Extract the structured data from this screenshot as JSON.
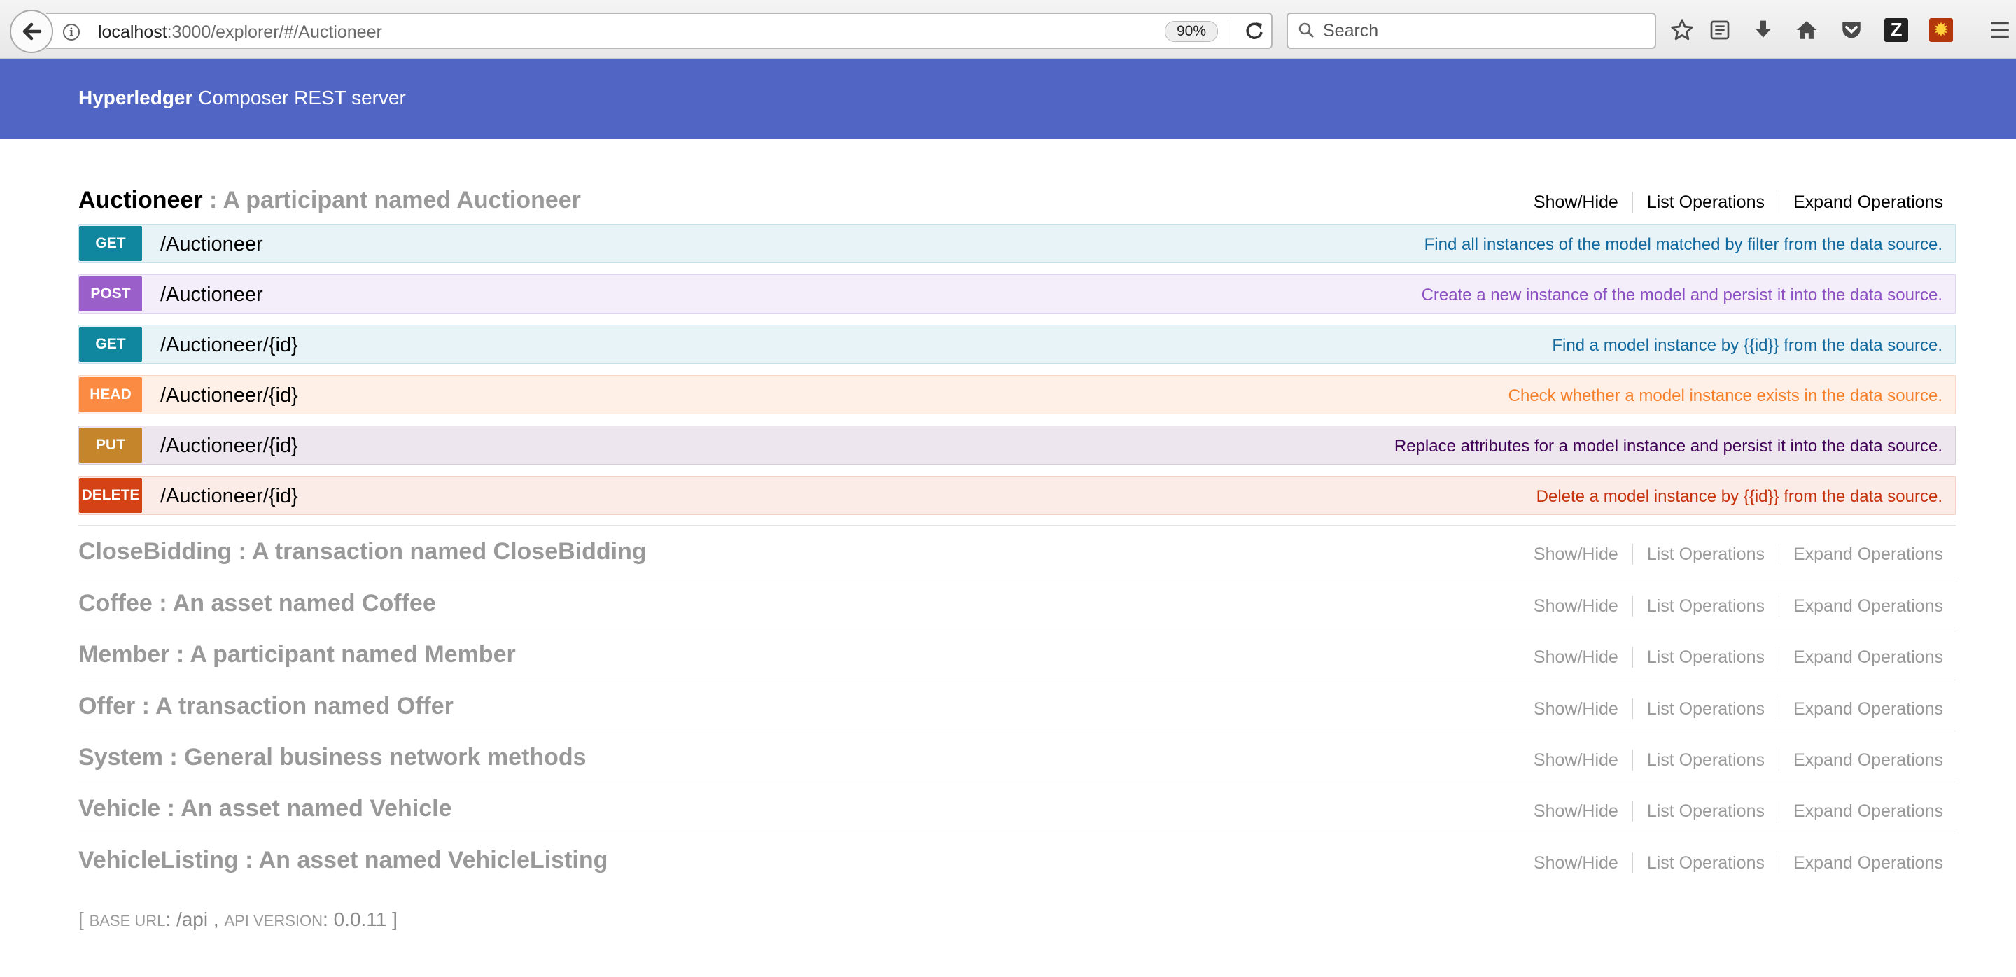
{
  "browser": {
    "url_host": "localhost",
    "url_rest": ":3000/explorer/#/Auctioneer",
    "zoom": "90%",
    "search_placeholder": "Search"
  },
  "header": {
    "brand": "Hyperledger",
    "subtitle": " Composer REST server",
    "background_color": "#5166c4"
  },
  "active_resource": {
    "name": "Auctioneer",
    "description": " : A participant named Auctioneer",
    "links": [
      "Show/Hide",
      "List Operations",
      "Expand Operations"
    ],
    "operations": [
      {
        "method": "GET",
        "path": "/Auctioneer",
        "summary": "Find all instances of the model matched by filter from the data source."
      },
      {
        "method": "POST",
        "path": "/Auctioneer",
        "summary": "Create a new instance of the model and persist it into the data source."
      },
      {
        "method": "GET",
        "path": "/Auctioneer/{id}",
        "summary": "Find a model instance by {{id}} from the data source."
      },
      {
        "method": "HEAD",
        "path": "/Auctioneer/{id}",
        "summary": "Check whether a model instance exists in the data source."
      },
      {
        "method": "PUT",
        "path": "/Auctioneer/{id}",
        "summary": "Replace attributes for a model instance and persist it into the data source."
      },
      {
        "method": "DELETE",
        "path": "/Auctioneer/{id}",
        "summary": "Delete a model instance by {{id}} from the data source."
      }
    ]
  },
  "other_resources": [
    {
      "title": "CloseBidding : A transaction named CloseBidding"
    },
    {
      "title": "Coffee : An asset named Coffee"
    },
    {
      "title": "Member : A participant named Member"
    },
    {
      "title": "Offer : A transaction named Offer"
    },
    {
      "title": "System : General business network methods"
    },
    {
      "title": "Vehicle : An asset named Vehicle"
    },
    {
      "title": "VehicleListing : An asset named VehicleListing"
    }
  ],
  "resource_links": [
    "Show/Hide",
    "List Operations",
    "Expand Operations"
  ],
  "footer": {
    "open_bracket": "[ ",
    "base_url_label": "BASE URL",
    "base_url_value": ": /api , ",
    "api_version_label": "API VERSION",
    "api_version_value": ": 0.0.11 ]"
  },
  "icons": [
    "back-arrow-icon",
    "info-icon",
    "reload-icon",
    "search-icon",
    "star-icon",
    "reading-list-icon",
    "download-icon",
    "home-icon",
    "pocket-icon",
    "zotero-icon",
    "extension-sun-icon",
    "menu-icon"
  ]
}
